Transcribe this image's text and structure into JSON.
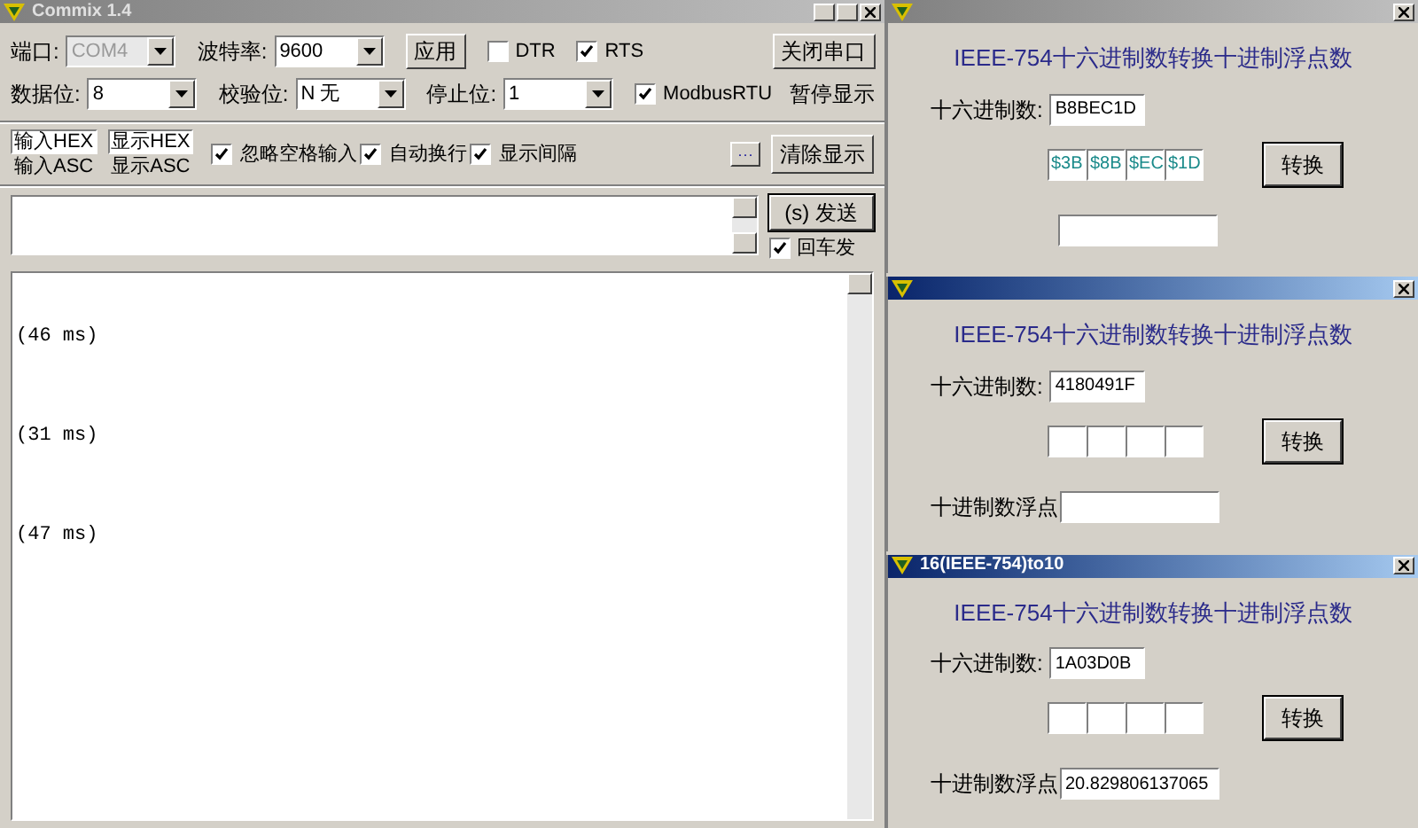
{
  "main_window": {
    "title": "Commix 1.4",
    "rows": [
      [
        {
          "kind": "combo",
          "label": "端口:",
          "value": "COM4",
          "disabled": true
        },
        {
          "kind": "combo",
          "label": "波特率:",
          "value": "9600",
          "disabled": false
        },
        {
          "kind": "button",
          "label": "应用"
        },
        {
          "kind": "checkbox",
          "label": "DTR",
          "checked": false
        },
        {
          "kind": "checkbox",
          "label": "RTS",
          "checked": true
        }
      ],
      [
        {
          "kind": "combo",
          "label": "数据位:",
          "value": "8",
          "disabled": false
        },
        {
          "kind": "combo",
          "label": "校验位:",
          "value": "N 无",
          "disabled": false
        },
        {
          "kind": "combo",
          "label": "停止位:",
          "value": "1",
          "disabled": false
        },
        {
          "kind": "checkbox",
          "label": "ModbusRTU",
          "checked": true
        }
      ]
    ],
    "side_controls": [
      {
        "kind": "button",
        "label": "关闭串口"
      },
      {
        "kind": "text",
        "label": "暂停显示"
      }
    ],
    "toggles": [
      [
        {
          "label": "输入HEX",
          "selected": true
        },
        {
          "label": "输入ASC",
          "selected": false
        }
      ],
      [
        {
          "label": "显示HEX",
          "selected": true
        },
        {
          "label": "显示ASC",
          "selected": false
        }
      ]
    ],
    "options": [
      {
        "label": "忽略空格输入",
        "checked": true
      },
      {
        "label": "自动换行",
        "checked": true
      },
      {
        "label": "显示间隔",
        "checked": true
      }
    ],
    "more_button": "···",
    "clear_button": "清除显示",
    "send_button": "(s) 发送",
    "enter_send": {
      "label": "回车发",
      "checked": true
    },
    "log": [
      "(46 ms)",
      "(31 ms)",
      "(47 ms)"
    ]
  },
  "converters": [
    {
      "active": false,
      "heading": "IEEE-754十六进制数转换十进制浮点数",
      "hex_label": "十六进制数:",
      "hex_value": "B8BEC1D",
      "bytes": [
        "$3B",
        "$8B",
        "$EC",
        "$1D"
      ],
      "convert_button": "转换"
    },
    {
      "active": true,
      "heading": "IEEE-754十六进制数转换十进制浮点数",
      "hex_label": "十六进制数:",
      "hex_value": "4180491F",
      "convert_button": "转换",
      "decimal_label": "十进制数浮点"
    },
    {
      "title": "16(IEEE-754)to10",
      "active": true,
      "heading": "IEEE-754十六进制数转换十进制浮点数",
      "hex_label": "十六进制数:",
      "hex_value": "1A03D0B",
      "convert_button": "转换",
      "decimal_label": "十进制数浮点",
      "decimal_value": "20.829806137065"
    }
  ]
}
